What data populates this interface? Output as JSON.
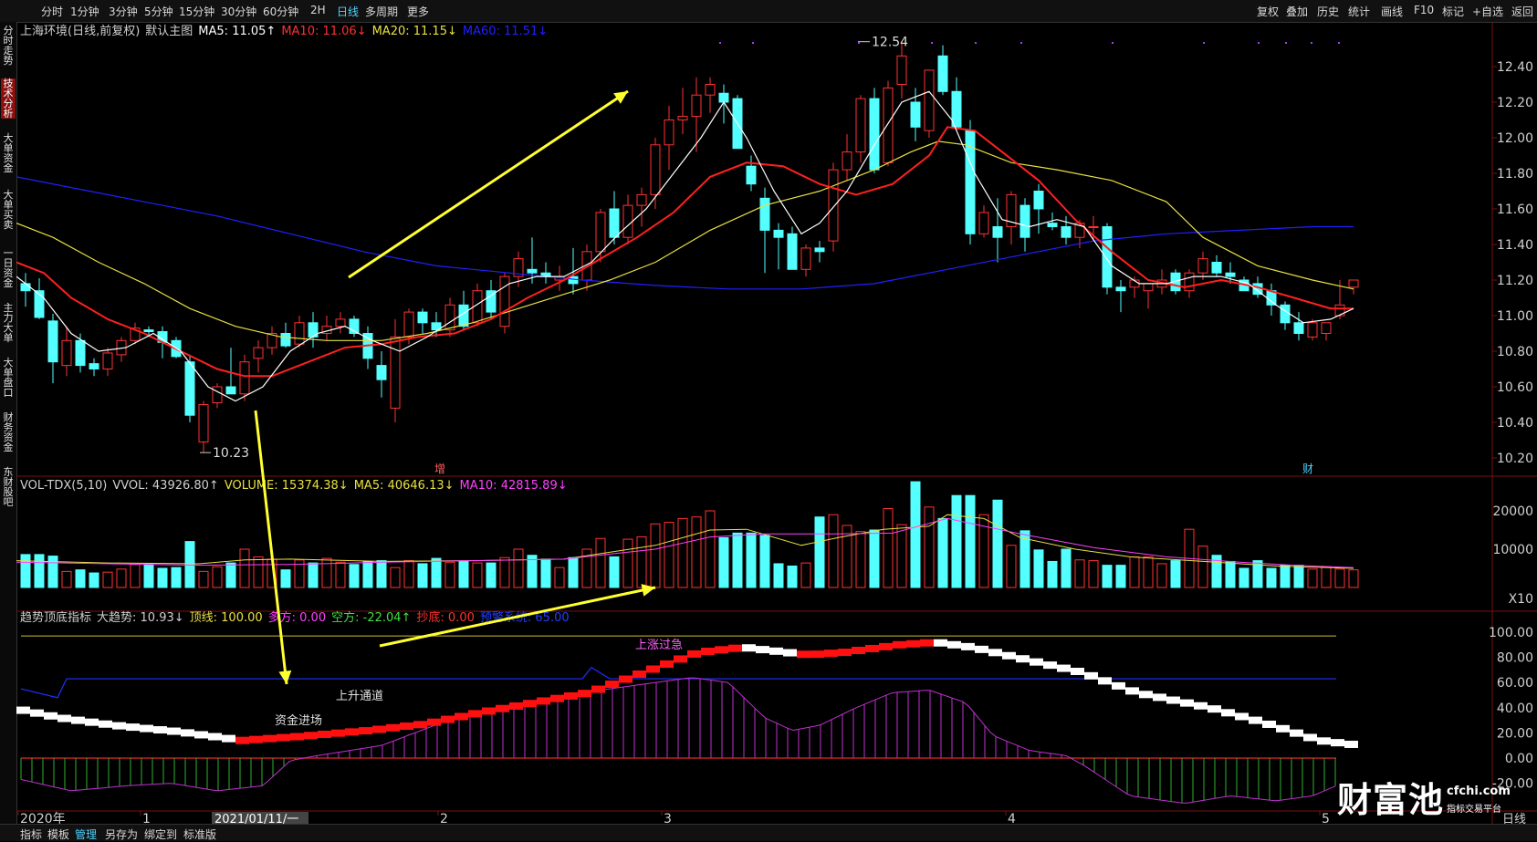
{
  "toolbar": {
    "periods": [
      "分时",
      "1分钟",
      "3分钟",
      "5分钟",
      "15分钟",
      "30分钟",
      "60分钟",
      "2H",
      "日线",
      "多周期",
      "更多"
    ],
    "active_period": "日线",
    "right_items": [
      "复权",
      "叠加",
      "历史",
      "统计",
      "画线",
      "F10",
      "标记",
      "+自选",
      "返回"
    ]
  },
  "sidebar": {
    "tabs": [
      "分时走势",
      "技术分析",
      "大单资金",
      "大单买卖",
      "一日资金",
      "主力大单",
      "大单盘口",
      "财务资金",
      "东财股吧"
    ],
    "active_index": 1
  },
  "main_panel": {
    "legend": [
      {
        "text": "上海环境(日线,前复权)",
        "color": "#d0d0d0"
      },
      {
        "text": "默认主图",
        "color": "#d0d0d0"
      },
      {
        "text": "MA5: 11.05↑",
        "color": "#ffffff"
      },
      {
        "text": "MA10: 11.06↓",
        "color": "#ff3030"
      },
      {
        "text": "MA20: 11.15↓",
        "color": "#e8e040"
      },
      {
        "text": "MA60: 11.51↓",
        "color": "#2020ff"
      }
    ],
    "y_ticks": [
      "12.40",
      "12.20",
      "12.00",
      "11.80",
      "11.60",
      "11.40",
      "11.20",
      "11.00",
      "10.80",
      "10.60",
      "10.40",
      "10.20"
    ],
    "high_label": "12.54",
    "low_label": "10.23",
    "markers": [
      "增",
      "财"
    ]
  },
  "volume_panel": {
    "legend": [
      {
        "text": "VOL-TDX(5,10)",
        "color": "#d0d0d0"
      },
      {
        "text": "VVOL: 43926.80↑",
        "color": "#d0d0d0"
      },
      {
        "text": "VOLUME: 15374.38↓",
        "color": "#e8e040"
      },
      {
        "text": "MA5: 40646.13↓",
        "color": "#e8e040"
      },
      {
        "text": "MA10: 42815.89↓",
        "color": "#ff40ff"
      }
    ],
    "y_ticks": [
      "20000",
      "10000",
      "X10"
    ]
  },
  "indicator_panel": {
    "legend": [
      {
        "text": "趋势顶底指标",
        "color": "#d0d0d0"
      },
      {
        "text": "大趋势: 10.93↓",
        "color": "#d0d0d0"
      },
      {
        "text": "顶线: 100.00",
        "color": "#e8e040"
      },
      {
        "text": "多方: 0.00",
        "color": "#ff40ff"
      },
      {
        "text": "空方: -22.04↑",
        "color": "#40e040"
      },
      {
        "text": "抄底: 0.00",
        "color": "#ff3030"
      },
      {
        "text": "预警系统: 65.00",
        "color": "#2040ff"
      }
    ],
    "y_ticks": [
      "100.00",
      "80.00",
      "60.00",
      "40.00",
      "20.00",
      "0.00",
      "-20.00"
    ],
    "annotations": [
      "上升通道",
      "资金进场",
      "上涨过急"
    ]
  },
  "x_axis": {
    "labels": [
      "2020年",
      "1",
      "2",
      "3",
      "4",
      "5"
    ],
    "cursor_date": "2021/01/11/一",
    "period_label": "日线"
  },
  "bottom_tabs": [
    "指标",
    "模板",
    "管理",
    "另存为",
    "绑定到",
    "标准版"
  ],
  "bottom_active": "管理",
  "watermark": {
    "name": "财富池",
    "url": "cfchi.com",
    "tagline": "指标交易平台"
  },
  "colors": {
    "up": "#ff3232",
    "down": "#54ffff",
    "ma5": "#ffffff",
    "ma10": "#ff2020",
    "ma20": "#e8e040",
    "ma60": "#2020ff",
    "arrow": "#ffff30"
  }
}
